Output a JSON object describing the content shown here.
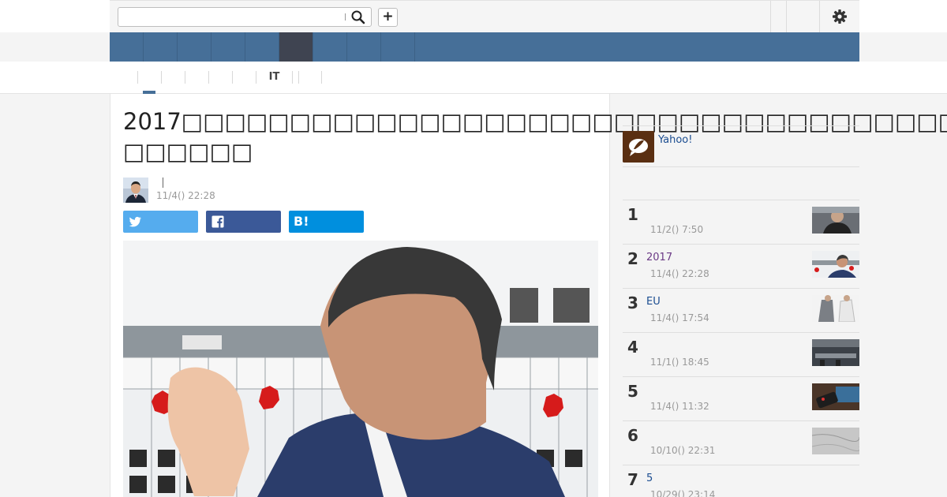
{
  "search": {
    "value": "",
    "placeholder": ""
  },
  "topbar": {
    "plus_label": "+"
  },
  "nav": {
    "items": [
      "",
      "",
      "",
      "",
      "",
      "",
      "",
      "",
      ""
    ],
    "active_index": 5
  },
  "subnav": {
    "items": [
      "",
      "",
      "",
      "",
      "",
      "IT",
      "",
      ""
    ],
    "active_index": 0
  },
  "article": {
    "title": "2017□□□□□□□□□□□□□□□□□□□□□□□□□□□□□□□□□□□□□",
    "title_line2": "□□□□□□",
    "author": "",
    "date": "11/4() 22:28",
    "share": {
      "twitter": "",
      "facebook": "",
      "hatena": "B!"
    }
  },
  "sidebar": {
    "promo_text": "Yahoo!",
    "ranking": [
      {
        "rank": "1",
        "title": "",
        "date": "11/2() 7:50",
        "visited": false
      },
      {
        "rank": "2",
        "title": "2017",
        "date": "11/4() 22:28",
        "visited": true
      },
      {
        "rank": "3",
        "title": "EU",
        "date": "11/4() 17:54",
        "visited": false
      },
      {
        "rank": "4",
        "title": "",
        "date": "11/1() 18:45",
        "visited": false
      },
      {
        "rank": "5",
        "title": "",
        "date": "11/4() 11:32",
        "visited": false
      },
      {
        "rank": "6",
        "title": "",
        "date": "10/10() 22:31",
        "visited": false
      },
      {
        "rank": "7",
        "title": "5",
        "date": "10/29() 23:14",
        "visited": false
      }
    ]
  },
  "colors": {
    "nav_bg": "#466f98",
    "nav_active": "#3f4451",
    "twitter": "#55acee",
    "facebook": "#3b5998",
    "hatena": "#008fde",
    "link": "#1a4c90",
    "visited": "#6b3a86"
  },
  "icons": {
    "search": "search-icon",
    "gear": "gear-icon",
    "twitter": "twitter-icon",
    "facebook": "facebook-icon",
    "hatena": "hatena-bookmark-icon",
    "promo": "quill-speech-icon"
  }
}
